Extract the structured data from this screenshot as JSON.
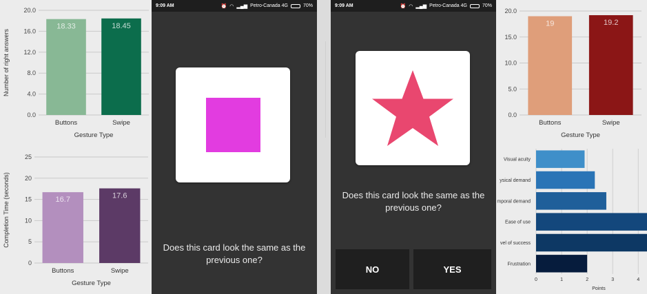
{
  "chart_data": [
    {
      "type": "bar",
      "ylabel": "Number of right answers",
      "xlabel": "Gesture Type",
      "categories": [
        "Buttons",
        "Swipe"
      ],
      "values": [
        18.33,
        18.45
      ],
      "data_labels": [
        "18.33",
        "18.45"
      ],
      "colors": [
        "#88b895",
        "#0c6d4c"
      ],
      "ylim": [
        0,
        20
      ],
      "yticks": [
        "0.0",
        "4.0",
        "8.0",
        "12.0",
        "16.0",
        "20.0"
      ],
      "grid": true
    },
    {
      "type": "bar",
      "ylabel": "Completion Time (seconds)",
      "xlabel": "Gesture Type",
      "categories": [
        "Buttons",
        "Swipe"
      ],
      "values": [
        16.7,
        17.6
      ],
      "data_labels": [
        "16.7",
        "17.6"
      ],
      "colors": [
        "#b38fbe",
        "#5c3a66"
      ],
      "ylim": [
        0,
        25
      ],
      "yticks": [
        "0",
        "5",
        "10",
        "15",
        "20",
        "25"
      ],
      "grid": true
    },
    {
      "type": "bar",
      "xlabel": "Gesture Type",
      "categories": [
        "Buttons",
        "Swipe"
      ],
      "values": [
        19,
        19.2
      ],
      "data_labels": [
        "19",
        "19.2"
      ],
      "colors": [
        "#df9e7a",
        "#8b1616"
      ],
      "ylim": [
        0,
        20
      ],
      "yticks": [
        "0.0",
        "5.0",
        "10.0",
        "15.0",
        "20.0"
      ],
      "grid": true
    },
    {
      "type": "bar",
      "orientation": "horizontal",
      "xlabel": "Points",
      "categories": [
        "Visual acuity",
        "Physical demand",
        "Temporal demand",
        "Ease of use",
        "Level of success",
        "Frustration"
      ],
      "category_labels": [
        "Visual acuity",
        "ysical demand",
        "mporal demand",
        "Ease of use",
        "vel of success",
        "Frustration"
      ],
      "values": [
        1.9,
        2.3,
        2.75,
        4.5,
        4.6,
        2.0
      ],
      "colors": [
        "#3f8fc9",
        "#2a74b6",
        "#1f5f9a",
        "#13477c",
        "#0d3864",
        "#061c3d"
      ],
      "xticks": [
        "0",
        "1",
        "2",
        "3",
        "4"
      ],
      "xlim": [
        0,
        4.1
      ],
      "grid": true
    }
  ],
  "phone_left": {
    "status": {
      "time": "9:09 AM",
      "carrier": "Petro-Canada 4G",
      "battery": "70%"
    },
    "card_shape": "square",
    "shape_color": "#e23ce0",
    "question": "Does this card look the same as the previous one?"
  },
  "phone_right": {
    "status": {
      "time": "9:09 AM",
      "carrier": "Petro-Canada 4G",
      "battery": "70%"
    },
    "card_shape": "star",
    "shape_color": "#e9476f",
    "question": "Does this card look the same as the previous one?",
    "no_label": "NO",
    "yes_label": "YES"
  }
}
